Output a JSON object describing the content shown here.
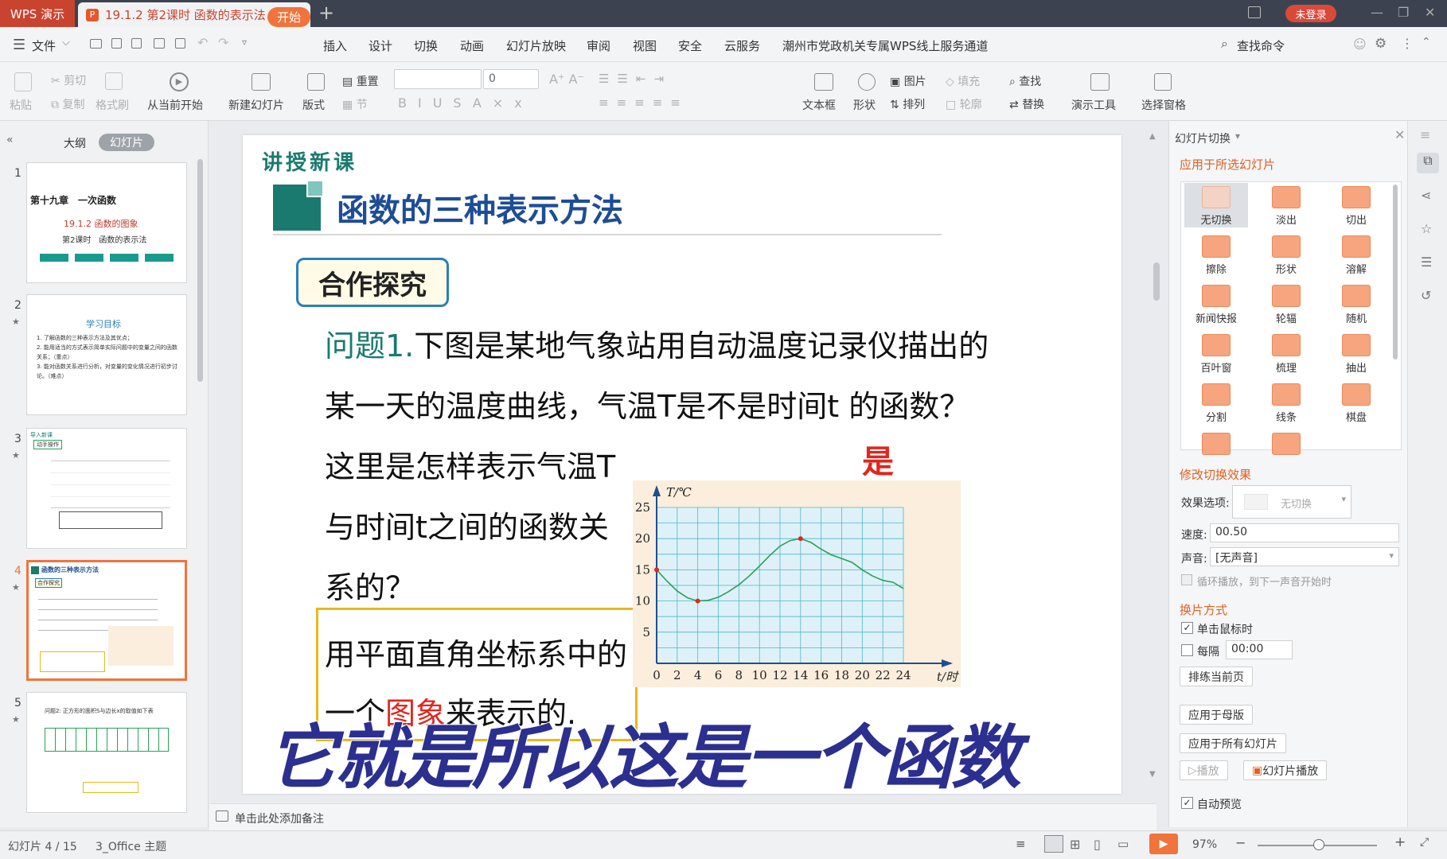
{
  "title_bar": {
    "app_tab": "WPS 演示",
    "doc_tab": "19.1.2 第2课时 函数的表示法",
    "login_button": "未登录"
  },
  "menu": {
    "file": "文件",
    "items": [
      "开始",
      "插入",
      "设计",
      "切换",
      "动画",
      "幻灯片放映",
      "审阅",
      "视图",
      "安全",
      "云服务",
      "潮州市党政机关专属WPS线上服务通道"
    ],
    "search": "查找命令"
  },
  "toolbar": {
    "paste": "粘贴",
    "cut": "剪切",
    "copy": "复制",
    "format_painter": "格式刷",
    "from_current": "从当前开始",
    "new_slide": "新建幻灯片",
    "layout": "版式",
    "reset": "重置",
    "section": "节",
    "font_size": "0",
    "textbox": "文本框",
    "shape": "形状",
    "picture": "图片",
    "arrange": "排列",
    "fill": "填充",
    "outline": "轮廓",
    "find": "查找",
    "replace": "替换",
    "present_tools": "演示工具",
    "selection_pane": "选择窗格"
  },
  "left_panel": {
    "tab_outline": "大纲",
    "tab_slides": "幻灯片",
    "thumbs": [
      {
        "num": "1",
        "title": "第十九章　一次函数",
        "sub": "19.1.2 函数的图象",
        "sub2": "第2课时　函数的表示法"
      },
      {
        "num": "2",
        "title": "学习目标",
        "lines": [
          "1. 了解函数的三种表示方法及其优点；",
          "2. 能用适当的方式表示简单实际问题中的变量之间的函数关系；（重点）",
          "3. 能对函数关系进行分析，对变量的变化情况进行初步讨论。（难点）"
        ]
      },
      {
        "num": "3",
        "title": "导入新课",
        "tag": "动手操作"
      },
      {
        "num": "4",
        "title": "函数的三种表示方法",
        "tag": "合作探究"
      },
      {
        "num": "5",
        "title": "问题2: 正方形的面积S与边长x的取值如下表"
      }
    ]
  },
  "slide": {
    "section_label": "讲授新课",
    "heading": "函数的三种表示方法",
    "badge": "合作探究",
    "q_prefix": "问题1.",
    "q_line1": "下图是某地气象站用自动温度记录仪描出的",
    "q_line2": "某一天的温度曲线，气温T是不是时间t 的函数？",
    "q_line3": "这里是怎样表示气温T",
    "q_line4": "与时间t之间的函数关",
    "q_line5": "系的？",
    "answer_yes": "是",
    "answer_box_line1": "用平面直角坐标系中的",
    "answer_box_line2_a": "一个",
    "answer_box_line2_b": "图象",
    "answer_box_line2_c": "来表示的.",
    "caption": "它就是所以这是一个函数"
  },
  "chart_data": {
    "type": "line",
    "ylabel": "T/℃",
    "xlabel": "t/时",
    "x_ticks": [
      "0",
      "2",
      "4",
      "6",
      "8",
      "10",
      "12",
      "14",
      "16",
      "18",
      "20",
      "22",
      "24"
    ],
    "y_ticks": [
      "5",
      "10",
      "15",
      "20",
      "25"
    ],
    "xlim": [
      0,
      24
    ],
    "ylim": [
      0,
      25
    ],
    "x": [
      0,
      1,
      2,
      3,
      4,
      5,
      6,
      7,
      8,
      9,
      10,
      11,
      12,
      13,
      14,
      15,
      16,
      17,
      18,
      19,
      20,
      21,
      22,
      23,
      24
    ],
    "y": [
      15,
      13.2,
      11.6,
      10.5,
      10,
      10.1,
      10.6,
      11.5,
      12.6,
      14,
      15.6,
      17.3,
      18.8,
      19.7,
      20,
      19.4,
      18.3,
      17.4,
      16.8,
      16.2,
      15,
      14,
      13.3,
      13,
      12
    ],
    "highlight_points": [
      {
        "x": 0,
        "y": 15
      },
      {
        "x": 4,
        "y": 10
      },
      {
        "x": 14,
        "y": 20
      }
    ],
    "colors": {
      "line": "#2aa05a",
      "grid": "#4cb8c8",
      "bg": "#dff1f8",
      "panel": "#fbeedd",
      "point": "#e0261d"
    }
  },
  "notes": {
    "placeholder": "单击此处添加备注"
  },
  "right_pane": {
    "title": "幻灯片切换",
    "apply_selected": "应用于所选幻灯片",
    "transitions": [
      "无切换",
      "淡出",
      "切出",
      "擦除",
      "形状",
      "溶解",
      "新闻快报",
      "轮辐",
      "随机",
      "百叶窗",
      "梳理",
      "抽出",
      "分割",
      "线条",
      "棋盘",
      "",
      ""
    ],
    "modify": "修改切换效果",
    "effect_label": "效果选项:",
    "effect_value": "无切换",
    "speed_label": "速度:",
    "speed_value": "00.50",
    "sound_label": "声音:",
    "sound_value": "[无声音]",
    "loop_label": "循环播放，到下一声音开始时",
    "advance": "换片方式",
    "on_click": "单击鼠标时",
    "every": "每隔",
    "every_value": "00:00",
    "rehearse": "排练当前页",
    "apply_master": "应用于母版",
    "apply_all": "应用于所有幻灯片",
    "play": "播放",
    "slideshow": "幻灯片播放",
    "auto_preview": "自动预览"
  },
  "status": {
    "slide_info": "幻灯片 4 / 15",
    "theme": "3_Office 主题",
    "zoom": "97%"
  }
}
